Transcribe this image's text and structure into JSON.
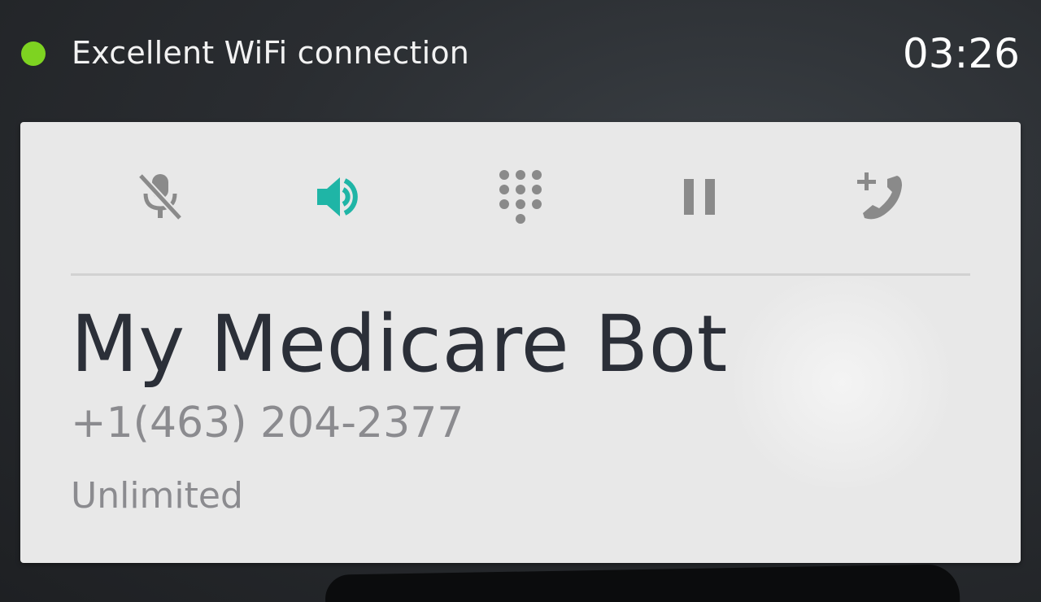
{
  "status_bar": {
    "connection_text": "Excellent WiFi connection",
    "connection_color": "#7ed321",
    "call_timer": "03:26"
  },
  "controls": [
    {
      "icon": "mic-off-icon",
      "name": "mute-button",
      "active": false
    },
    {
      "icon": "speaker-icon",
      "name": "speaker-button",
      "active": true
    },
    {
      "icon": "dialpad-icon",
      "name": "dialpad-button",
      "active": false
    },
    {
      "icon": "pause-icon",
      "name": "hold-button",
      "active": false
    },
    {
      "icon": "add-call-icon",
      "name": "add-call-button",
      "active": false
    }
  ],
  "colors": {
    "accent": "#1fb5a6",
    "icon_inactive": "#8a8a8a",
    "card_background": "#e8e8e8"
  },
  "contact": {
    "name": "My Medicare Bot",
    "number": "+1(463) 204-2377",
    "label": "Unlimited"
  }
}
